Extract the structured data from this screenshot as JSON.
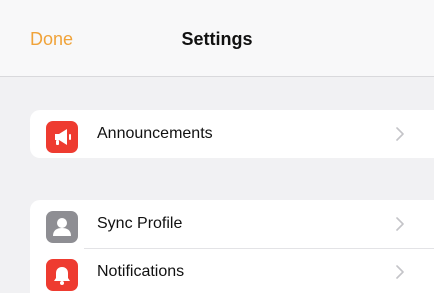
{
  "nav": {
    "done_label": "Done",
    "title": "Settings"
  },
  "groups": [
    {
      "items": [
        {
          "label": "Announcements",
          "icon": "megaphone-icon",
          "icon_color": "#ee3b30"
        }
      ]
    },
    {
      "items": [
        {
          "label": "Sync Profile",
          "icon": "person-icon",
          "icon_color": "#8e8e93"
        },
        {
          "label": "Notifications",
          "icon": "bell-icon",
          "icon_color": "#ee3b30"
        }
      ]
    }
  ],
  "colors": {
    "accent": "#f0a33a",
    "background": "#f1f1f3",
    "chevron": "#c4c4c8"
  }
}
